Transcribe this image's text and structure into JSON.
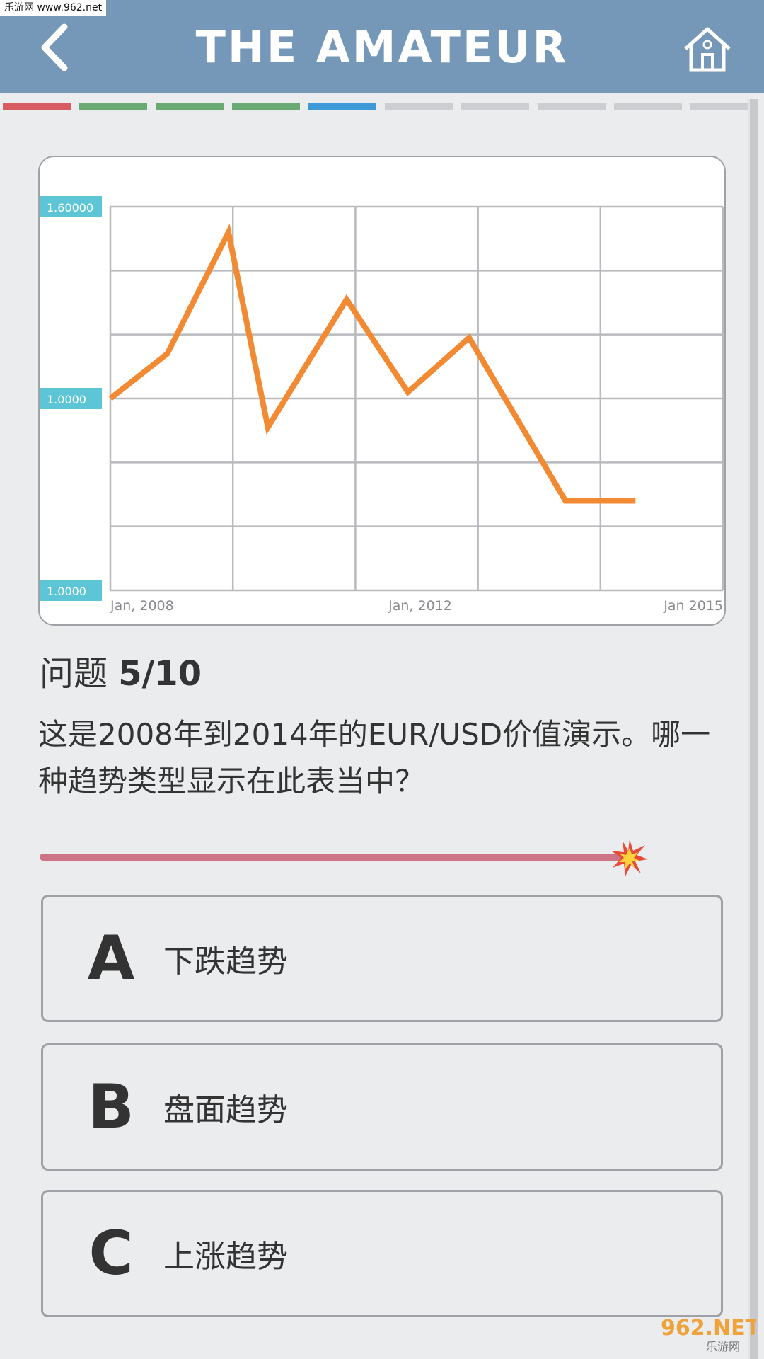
{
  "watermark": {
    "top_text": "乐游网 www.962.net",
    "logo_text": "962.NET",
    "logo_sub": "乐游网"
  },
  "header": {
    "title": "THE AMATEUR",
    "back_icon": "chevron-left-icon",
    "home_icon": "home-icon"
  },
  "progress": {
    "total": 10,
    "current": 5,
    "segments": [
      {
        "state": "wrong",
        "color": "#d95b62"
      },
      {
        "state": "correct",
        "color": "#6aa874"
      },
      {
        "state": "correct",
        "color": "#6aa874"
      },
      {
        "state": "correct",
        "color": "#6aa874"
      },
      {
        "state": "current",
        "color": "#3f99d6"
      },
      {
        "state": "pending",
        "color": "#cdced1"
      },
      {
        "state": "pending",
        "color": "#cdced1"
      },
      {
        "state": "pending",
        "color": "#cdced1"
      },
      {
        "state": "pending",
        "color": "#cdced1"
      },
      {
        "state": "pending",
        "color": "#cdced1"
      }
    ]
  },
  "chart_data": {
    "type": "line",
    "y_tick_labels": [
      {
        "label": "1.60000",
        "value": 1.6
      },
      {
        "label": "1.0000",
        "value": 1.0
      },
      {
        "label": "1.0000",
        "value": 0.4
      }
    ],
    "x_tick_labels": [
      "Jan, 2008",
      "Jan, 2012",
      "Jan 2015"
    ],
    "xlim": [
      2008,
      2015
    ],
    "ylim": [
      0.4,
      1.6
    ],
    "grid": true,
    "line_color": "#f28a33",
    "label_bg_color": "#5dc6d6",
    "series": [
      {
        "x": [
          2008.0,
          2008.65,
          2009.35,
          2009.8,
          2010.7,
          2011.4,
          2012.1,
          2013.2,
          2014.0
        ],
        "values": [
          1.0,
          1.14,
          1.52,
          0.91,
          1.31,
          1.02,
          1.19,
          0.68,
          0.68
        ]
      }
    ]
  },
  "question": {
    "label": "问题",
    "number": "5/10",
    "text": "这是2008年到2014年的EUR/USD价值演示。哪一种趋势类型显示在此表当中？"
  },
  "timer": {
    "remaining_fraction": 0.96,
    "color": "#cc7485",
    "icon": "spark-icon"
  },
  "options": [
    {
      "letter": "A",
      "label": "下跌趋势"
    },
    {
      "letter": "B",
      "label": "盘面趋势"
    },
    {
      "letter": "C",
      "label": "上涨趋势"
    }
  ]
}
